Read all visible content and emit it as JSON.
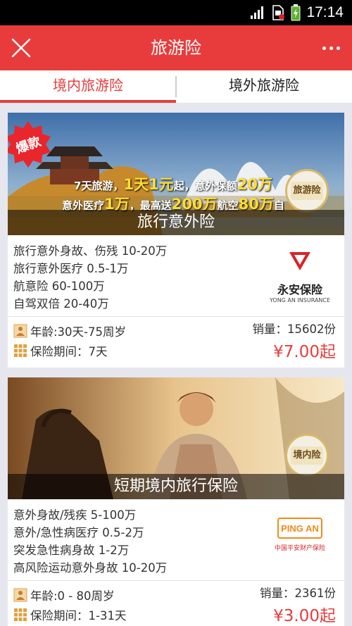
{
  "status_bar": {
    "time": "17:14"
  },
  "header": {
    "title": "旅游险"
  },
  "tabs": [
    {
      "label": "境内旅游险",
      "active": true
    },
    {
      "label": "境外旅游险",
      "active": false
    }
  ],
  "cards": [
    {
      "hot_badge": "爆款",
      "promo_line1_a": "7天旅游，",
      "promo_line1_b": "1天1元",
      "promo_line1_c": "起，意外保额",
      "promo_line1_d": "20万",
      "promo_line2_a": "意外医疗",
      "promo_line2_b": "1万",
      "promo_line2_c": "，最高送",
      "promo_line2_d": "200万",
      "promo_line2_e": "航空",
      "promo_line2_f": "80万",
      "promo_line2_g": "自驾",
      "badge_label": "旅游险",
      "banner_title": "旅行意外险",
      "coverage": [
        "旅行意外身故、伤残  10-20万",
        "旅行意外医疗  0.5-1万",
        "航意险  60-100万",
        "自驾双倍  20-40万"
      ],
      "insurer_name": "永安保险",
      "insurer_sub": "YONG AN INSURANCE",
      "age": "年龄:30天-75周岁",
      "period": "保险期间：7天",
      "sales": "销量：15602份",
      "price": "¥7.00起"
    },
    {
      "badge_label": "境内险",
      "banner_title": "短期境内旅行保险",
      "coverage": [
        "意外身故/残疾  5-100万",
        "意外/急性病医疗  0.5-2万",
        "突发急性病身故  1-2万",
        "高风险运动意外身故  10-20万"
      ],
      "insurer_name": "PING AN",
      "insurer_sub": "中国平安财产保险",
      "age": "年龄:0 - 80周岁",
      "period": "保险期间：1-31天",
      "sales": "销量：2361份",
      "price": "¥3.00起"
    }
  ],
  "colors": {
    "accent": "#e83c3c",
    "status_bar": "#000000",
    "background": "#e6e6ee"
  }
}
